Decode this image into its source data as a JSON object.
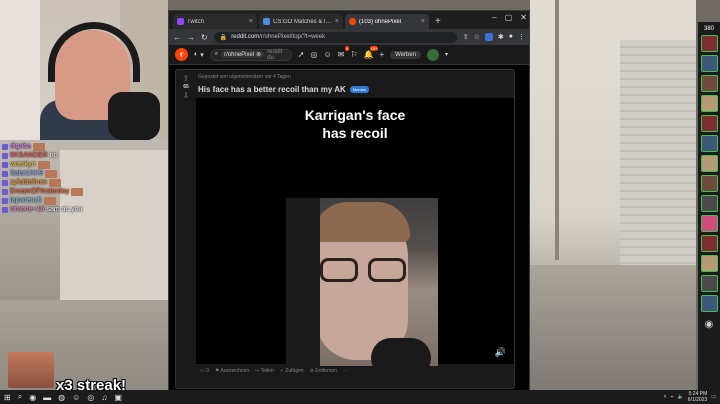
{
  "chat": {
    "lines": [
      {
        "user": "digaba",
        "msg": ""
      },
      {
        "user": "0KSANDER",
        "msg": "no"
      },
      {
        "user": "wreckyn",
        "msg": ""
      },
      {
        "user": "Salat1KK9",
        "msg": ""
      },
      {
        "user": "zyfuldefinex",
        "msg": ""
      },
      {
        "user": "DreamOfYesterday",
        "msg": ""
      },
      {
        "user": "lapwrench",
        "msg": ""
      },
      {
        "user": "simone+16",
        "msg": "sam as you"
      }
    ]
  },
  "overlay": {
    "streak": "x3 streak!"
  },
  "browser": {
    "tabs": [
      {
        "title": "Twitch",
        "color": "#9146ff"
      },
      {
        "title": "CS:GO Matches & livescore | H",
        "color": "#4a90e2"
      },
      {
        "title": "(103) ohnePixel",
        "color": "#ff4500"
      }
    ],
    "url": {
      "host": "reddit.com",
      "path": "/r/ohnePixel/top/?t=week"
    }
  },
  "reddit": {
    "logo": "r",
    "home_label": "",
    "search": {
      "community": "r/ohnePixel",
      "placeholder": "reddit du"
    },
    "notif_badge_1": "9",
    "notif_badge_2": "10+",
    "advertise": "Werben"
  },
  "post": {
    "score": "65",
    "meta": "Gepostet von  u/gemmimidzer vor 4 Tagen",
    "title": "His face has a better recoil than my AK",
    "flair": "Memes",
    "caption_line1": "Karrigan's face",
    "caption_line2": "has recoil",
    "actions": {
      "comments": "0",
      "award": "Auszeichnen",
      "share": "Teilen",
      "save": "Zufügen",
      "hide": "Entfernen"
    },
    "next_meta": "Gepostet von  u/ChristianRRR7 vor 5 Tagen"
  },
  "taskbar": {
    "time": "5:24 PM",
    "date": "6/1/2023"
  },
  "sidebar": {
    "viewer_count": "380"
  },
  "colors": {
    "reddit_orange": "#ff4500",
    "flair_blue": "#2f7ad8"
  }
}
